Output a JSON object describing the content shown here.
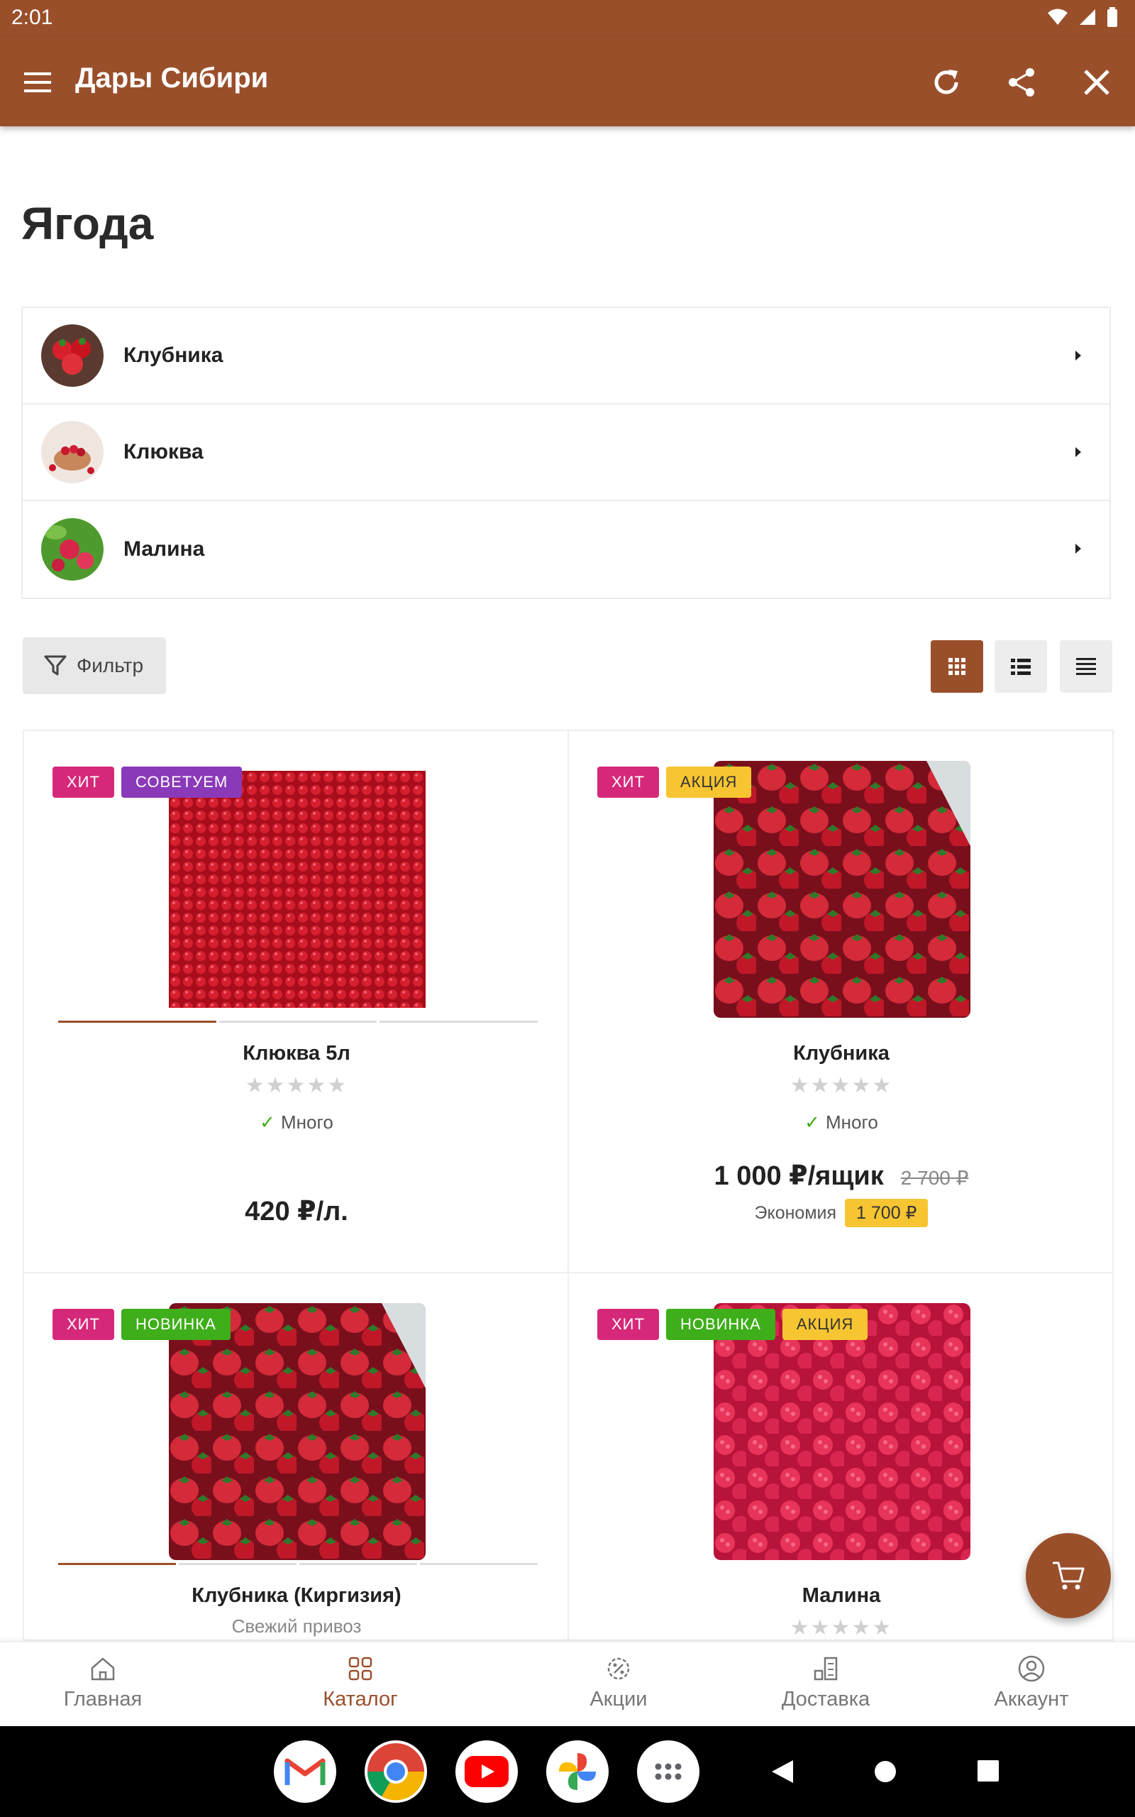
{
  "status": {
    "time": "2:01"
  },
  "appbar": {
    "title": "Дары Сибири"
  },
  "page": {
    "title": "Ягода"
  },
  "categories": [
    {
      "label": "Клубника"
    },
    {
      "label": "Клюква"
    },
    {
      "label": "Малина"
    }
  ],
  "toolbar": {
    "filter_label": "Фильтр"
  },
  "products": [
    {
      "badges": [
        "ХИТ",
        "СОВЕТУЕМ"
      ],
      "name": "Клюква 5л",
      "stock": "Много",
      "price": "420 ₽/л."
    },
    {
      "badges": [
        "ХИТ",
        "АКЦИЯ"
      ],
      "name": "Клубника",
      "stock": "Много",
      "price": "1 000 ₽/ящик",
      "old_price": "2 700 ₽",
      "economy_label": "Экономия",
      "economy_value": "1 700 ₽"
    },
    {
      "badges": [
        "ХИТ",
        "НОВИНКА"
      ],
      "name": "Клубника (Киргизия)",
      "subtitle": "Свежий привоз"
    },
    {
      "badges": [
        "ХИТ",
        "НОВИНКА",
        "АКЦИЯ"
      ],
      "name": "Малина"
    }
  ],
  "bottom_nav": [
    {
      "label": "Главная",
      "icon": "home-icon"
    },
    {
      "label": "Каталог",
      "icon": "catalog-icon",
      "active": true
    },
    {
      "label": "Акции",
      "icon": "discount-icon"
    },
    {
      "label": "Доставка",
      "icon": "delivery-icon"
    },
    {
      "label": "Аккаунт",
      "icon": "account-icon"
    }
  ],
  "colors": {
    "brand": "#9a4f2b",
    "hit": "#d6287a",
    "recommend": "#8a3ab9",
    "sale": "#f7c531",
    "new": "#3eae1a"
  }
}
